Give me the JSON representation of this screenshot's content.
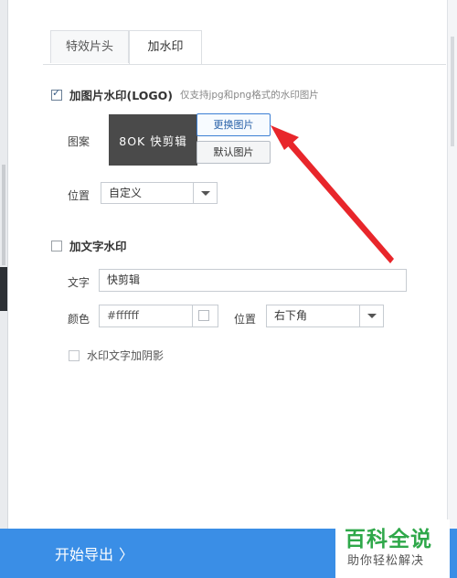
{
  "tabs": [
    {
      "label": "特效片头"
    },
    {
      "label": "加水印"
    }
  ],
  "image_watermark": {
    "checkbox_label": "加图片水印(LOGO)",
    "hint": "仅支持jpg和png格式的水印图片",
    "pattern_label": "图案",
    "logo_text": "8OK 快剪辑",
    "replace_button": "更换图片",
    "default_button": "默认图片",
    "position_label": "位置",
    "position_value": "自定义",
    "checked": true
  },
  "text_watermark": {
    "checkbox_label": "加文字水印",
    "checked": false,
    "text_label": "文字",
    "text_value": "快剪辑",
    "color_label": "颜色",
    "color_value": "#ffffff",
    "position_label": "位置",
    "position_value": "右下角",
    "shadow_label": "水印文字加阴影"
  },
  "footer": {
    "export_label": "开始导出",
    "export_chevron": "〉"
  },
  "watermark_badge": {
    "title": "百科全说",
    "subtitle": "助你轻松解决"
  },
  "colors": {
    "accent": "#3a8ee6",
    "annotation_arrow": "#e8262b",
    "badge_green": "#2fa84a"
  }
}
